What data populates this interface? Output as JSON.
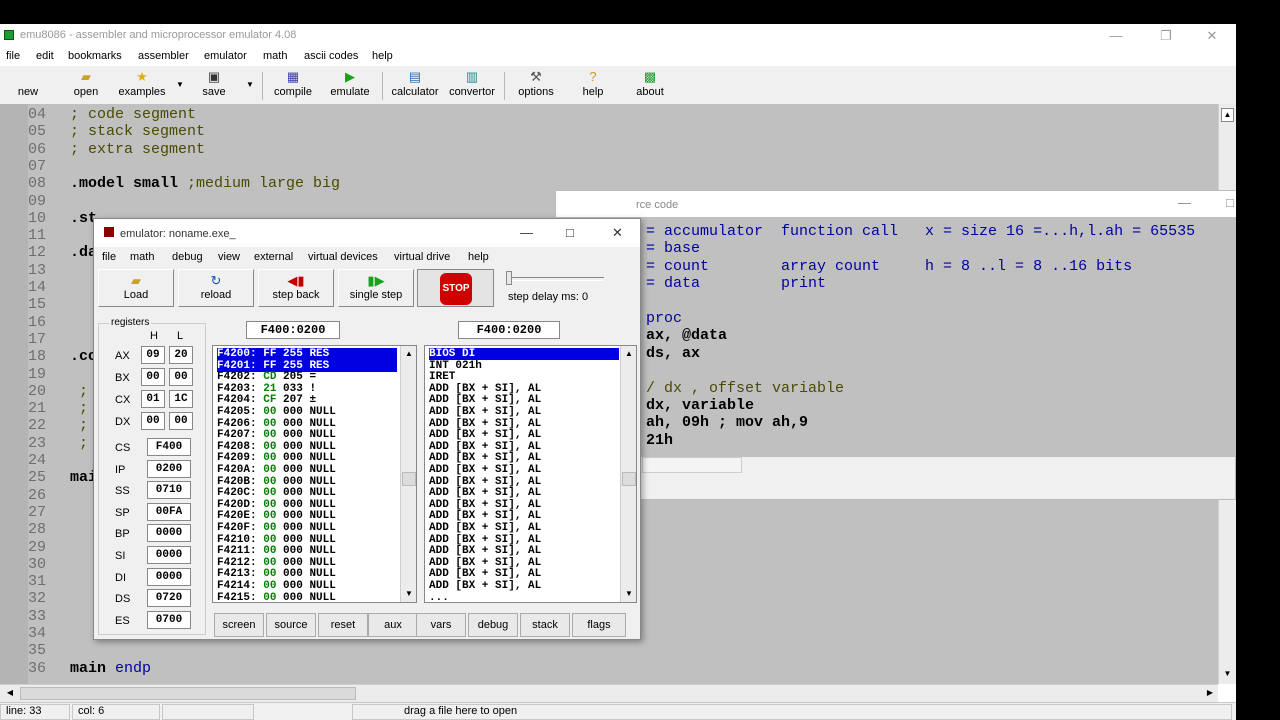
{
  "app": {
    "title": "emu8086 - assembler and microprocessor emulator 4.08",
    "window_controls": {
      "minimize": "—",
      "maximize": "❐",
      "close": "✕"
    }
  },
  "menu": [
    "file",
    "edit",
    "bookmarks",
    "assembler",
    "emulator",
    "math",
    "ascii codes",
    "help"
  ],
  "toolbar": [
    {
      "label": "new",
      "icon": "new-file-icon"
    },
    {
      "label": "open",
      "icon": "open-folder-icon"
    },
    {
      "label": "examples",
      "icon": "star-icon"
    },
    {
      "label": "save",
      "icon": "floppy-disk-icon"
    },
    {
      "label": "compile",
      "icon": "compile-icon"
    },
    {
      "label": "emulate",
      "icon": "play-icon"
    },
    {
      "label": "calculator",
      "icon": "calculator-icon"
    },
    {
      "label": "convertor",
      "icon": "convertor-icon"
    },
    {
      "label": "options",
      "icon": "tools-icon"
    },
    {
      "label": "help",
      "icon": "question-icon"
    },
    {
      "label": "about",
      "icon": "about-icon"
    }
  ],
  "editor": {
    "lines": [
      {
        "n": "04",
        "text": "; code segment",
        "cls": "c-com"
      },
      {
        "n": "05",
        "text": "; stack segment",
        "cls": "c-com"
      },
      {
        "n": "06",
        "text": "; extra segment",
        "cls": "c-com"
      },
      {
        "n": "07",
        "text": "",
        "cls": ""
      },
      {
        "n": "08",
        "text": ".model small",
        "cls": "c-dir",
        "suffix": " ;medium large big",
        "suffix_cls": "c-com"
      },
      {
        "n": "09",
        "text": "",
        "cls": ""
      },
      {
        "n": "10",
        "text": ".st",
        "cls": "c-dir"
      },
      {
        "n": "11",
        "text": "",
        "cls": ""
      },
      {
        "n": "12",
        "text": ".da",
        "cls": "c-dir"
      },
      {
        "n": "13",
        "text": "",
        "cls": ""
      },
      {
        "n": "14",
        "text": "",
        "cls": ""
      },
      {
        "n": "15",
        "text": "",
        "cls": ""
      },
      {
        "n": "16",
        "text": "",
        "cls": ""
      },
      {
        "n": "17",
        "text": "",
        "cls": ""
      },
      {
        "n": "18",
        "text": ".co",
        "cls": "c-dir"
      },
      {
        "n": "19",
        "text": "",
        "cls": ""
      },
      {
        "n": "20",
        "text": " ;",
        "cls": "c-com"
      },
      {
        "n": "21",
        "text": " ;",
        "cls": "c-com"
      },
      {
        "n": "22",
        "text": " ;",
        "cls": "c-com"
      },
      {
        "n": "23",
        "text": " ;",
        "cls": "c-com"
      },
      {
        "n": "24",
        "text": "",
        "cls": ""
      },
      {
        "n": "25",
        "text": "mai",
        "cls": "c-dir"
      },
      {
        "n": "26",
        "text": "",
        "cls": ""
      },
      {
        "n": "27",
        "text": "",
        "cls": ""
      },
      {
        "n": "28",
        "text": "",
        "cls": ""
      },
      {
        "n": "29",
        "text": "",
        "cls": ""
      },
      {
        "n": "30",
        "text": "",
        "cls": ""
      },
      {
        "n": "31",
        "text": "",
        "cls": ""
      },
      {
        "n": "32",
        "text": "",
        "cls": ""
      },
      {
        "n": "33",
        "text": "",
        "cls": ""
      },
      {
        "n": "34",
        "text": "",
        "cls": ""
      },
      {
        "n": "35",
        "text": "",
        "cls": ""
      },
      {
        "n": "36",
        "text": "main",
        "cls": "c-dir",
        "suffix": " endp",
        "suffix_cls": "c-kw"
      }
    ]
  },
  "original_source": {
    "title": "rce code",
    "lines": [
      {
        "text": "= accumulator  function call   x = size 16 =...h,l.ah = 65535",
        "cls": "c-kw"
      },
      {
        "text": "= base",
        "cls": "c-kw"
      },
      {
        "text": "= count        array count     h = 8 ..l = 8 ..16 bits",
        "cls": "c-kw"
      },
      {
        "text": "= data         print",
        "cls": "c-kw"
      },
      {
        "text": "",
        "cls": ""
      },
      {
        "text": "proc",
        "cls": "c-kw"
      },
      {
        "text": "ax, @data",
        "cls": "c-dir",
        "prefix_red": "ax"
      },
      {
        "text": "ds, ax",
        "cls": "c-dir"
      },
      {
        "text": "",
        "cls": ""
      },
      {
        "text": "/ dx , offset variable",
        "cls": "c-com"
      },
      {
        "text": "dx, variable",
        "cls": "c-dir"
      },
      {
        "text": "ah, 09h ; mov ah,9",
        "cls": "c-dir"
      },
      {
        "text": "21h",
        "cls": "c-dir"
      }
    ]
  },
  "emulator": {
    "title": "emulator: noname.exe_",
    "menu": [
      "file",
      "math",
      "debug",
      "view",
      "external",
      "virtual devices",
      "virtual drive",
      "help"
    ],
    "buttons": [
      {
        "label": "Load",
        "icon": "open-folder-icon"
      },
      {
        "label": "reload",
        "icon": "reload-icon"
      },
      {
        "label": "step back",
        "icon": "step-back-icon"
      },
      {
        "label": "single step",
        "icon": "single-step-icon"
      }
    ],
    "stop_label": "STOP",
    "step_delay": "step delay ms: 0",
    "registers_caption": "registers",
    "hl_header": {
      "h": "H",
      "l": "L"
    },
    "regs8": [
      {
        "name": "AX",
        "h": "09",
        "l": "20"
      },
      {
        "name": "BX",
        "h": "00",
        "l": "00"
      },
      {
        "name": "CX",
        "h": "01",
        "l": "1C"
      },
      {
        "name": "DX",
        "h": "00",
        "l": "00"
      }
    ],
    "regs16": [
      {
        "name": "CS",
        "v": "F400"
      },
      {
        "name": "IP",
        "v": "0200"
      },
      {
        "name": "SS",
        "v": "0710"
      },
      {
        "name": "SP",
        "v": "00FA"
      },
      {
        "name": "BP",
        "v": "0000"
      },
      {
        "name": "SI",
        "v": "0000"
      },
      {
        "name": "DI",
        "v": "0000"
      },
      {
        "name": "DS",
        "v": "0720"
      },
      {
        "name": "ES",
        "v": "0700"
      }
    ],
    "mem_addr": "F400:0200",
    "dis_addr": "F400:0200",
    "memory": [
      {
        "addr": "F4200:",
        "hex": "FF",
        "dec": "255",
        "ch": "RES",
        "sel": true
      },
      {
        "addr": "F4201:",
        "hex": "FF",
        "dec": "255",
        "ch": "RES",
        "sel": true
      },
      {
        "addr": "F4202:",
        "hex": "CD",
        "dec": "205",
        "ch": "=",
        "sel": false
      },
      {
        "addr": "F4203:",
        "hex": "21",
        "dec": "033",
        "ch": "!",
        "sel": false
      },
      {
        "addr": "F4204:",
        "hex": "CF",
        "dec": "207",
        "ch": "±",
        "sel": false
      },
      {
        "addr": "F4205:",
        "hex": "00",
        "dec": "000",
        "ch": "NULL",
        "sel": false
      },
      {
        "addr": "F4206:",
        "hex": "00",
        "dec": "000",
        "ch": "NULL",
        "sel": false
      },
      {
        "addr": "F4207:",
        "hex": "00",
        "dec": "000",
        "ch": "NULL",
        "sel": false
      },
      {
        "addr": "F4208:",
        "hex": "00",
        "dec": "000",
        "ch": "NULL",
        "sel": false
      },
      {
        "addr": "F4209:",
        "hex": "00",
        "dec": "000",
        "ch": "NULL",
        "sel": false
      },
      {
        "addr": "F420A:",
        "hex": "00",
        "dec": "000",
        "ch": "NULL",
        "sel": false
      },
      {
        "addr": "F420B:",
        "hex": "00",
        "dec": "000",
        "ch": "NULL",
        "sel": false
      },
      {
        "addr": "F420C:",
        "hex": "00",
        "dec": "000",
        "ch": "NULL",
        "sel": false
      },
      {
        "addr": "F420D:",
        "hex": "00",
        "dec": "000",
        "ch": "NULL",
        "sel": false
      },
      {
        "addr": "F420E:",
        "hex": "00",
        "dec": "000",
        "ch": "NULL",
        "sel": false
      },
      {
        "addr": "F420F:",
        "hex": "00",
        "dec": "000",
        "ch": "NULL",
        "sel": false
      },
      {
        "addr": "F4210:",
        "hex": "00",
        "dec": "000",
        "ch": "NULL",
        "sel": false
      },
      {
        "addr": "F4211:",
        "hex": "00",
        "dec": "000",
        "ch": "NULL",
        "sel": false
      },
      {
        "addr": "F4212:",
        "hex": "00",
        "dec": "000",
        "ch": "NULL",
        "sel": false
      },
      {
        "addr": "F4213:",
        "hex": "00",
        "dec": "000",
        "ch": "NULL",
        "sel": false
      },
      {
        "addr": "F4214:",
        "hex": "00",
        "dec": "000",
        "ch": "NULL",
        "sel": false
      },
      {
        "addr": "F4215:",
        "hex": "00",
        "dec": "000",
        "ch": "NULL",
        "sel": false
      }
    ],
    "disasm": [
      {
        "text": "BIOS DI",
        "sel": true
      },
      {
        "text": "INT 021h",
        "sel": false
      },
      {
        "text": "IRET",
        "sel": false
      },
      {
        "text": "ADD [BX + SI], AL",
        "sel": false
      },
      {
        "text": "ADD [BX + SI], AL",
        "sel": false
      },
      {
        "text": "ADD [BX + SI], AL",
        "sel": false
      },
      {
        "text": "ADD [BX + SI], AL",
        "sel": false
      },
      {
        "text": "ADD [BX + SI], AL",
        "sel": false
      },
      {
        "text": "ADD [BX + SI], AL",
        "sel": false
      },
      {
        "text": "ADD [BX + SI], AL",
        "sel": false
      },
      {
        "text": "ADD [BX + SI], AL",
        "sel": false
      },
      {
        "text": "ADD [BX + SI], AL",
        "sel": false
      },
      {
        "text": "ADD [BX + SI], AL",
        "sel": false
      },
      {
        "text": "ADD [BX + SI], AL",
        "sel": false
      },
      {
        "text": "ADD [BX + SI], AL",
        "sel": false
      },
      {
        "text": "ADD [BX + SI], AL",
        "sel": false
      },
      {
        "text": "ADD [BX + SI], AL",
        "sel": false
      },
      {
        "text": "ADD [BX + SI], AL",
        "sel": false
      },
      {
        "text": "ADD [BX + SI], AL",
        "sel": false
      },
      {
        "text": "ADD [BX + SI], AL",
        "sel": false
      },
      {
        "text": "ADD [BX + SI], AL",
        "sel": false
      },
      {
        "text": "...",
        "sel": false
      }
    ],
    "bottom_buttons": [
      "screen",
      "source",
      "reset",
      "aux",
      "vars",
      "debug",
      "stack",
      "flags"
    ]
  },
  "status": {
    "line": "line: 33",
    "col": "col: 6",
    "hint": "drag a file here to open"
  }
}
